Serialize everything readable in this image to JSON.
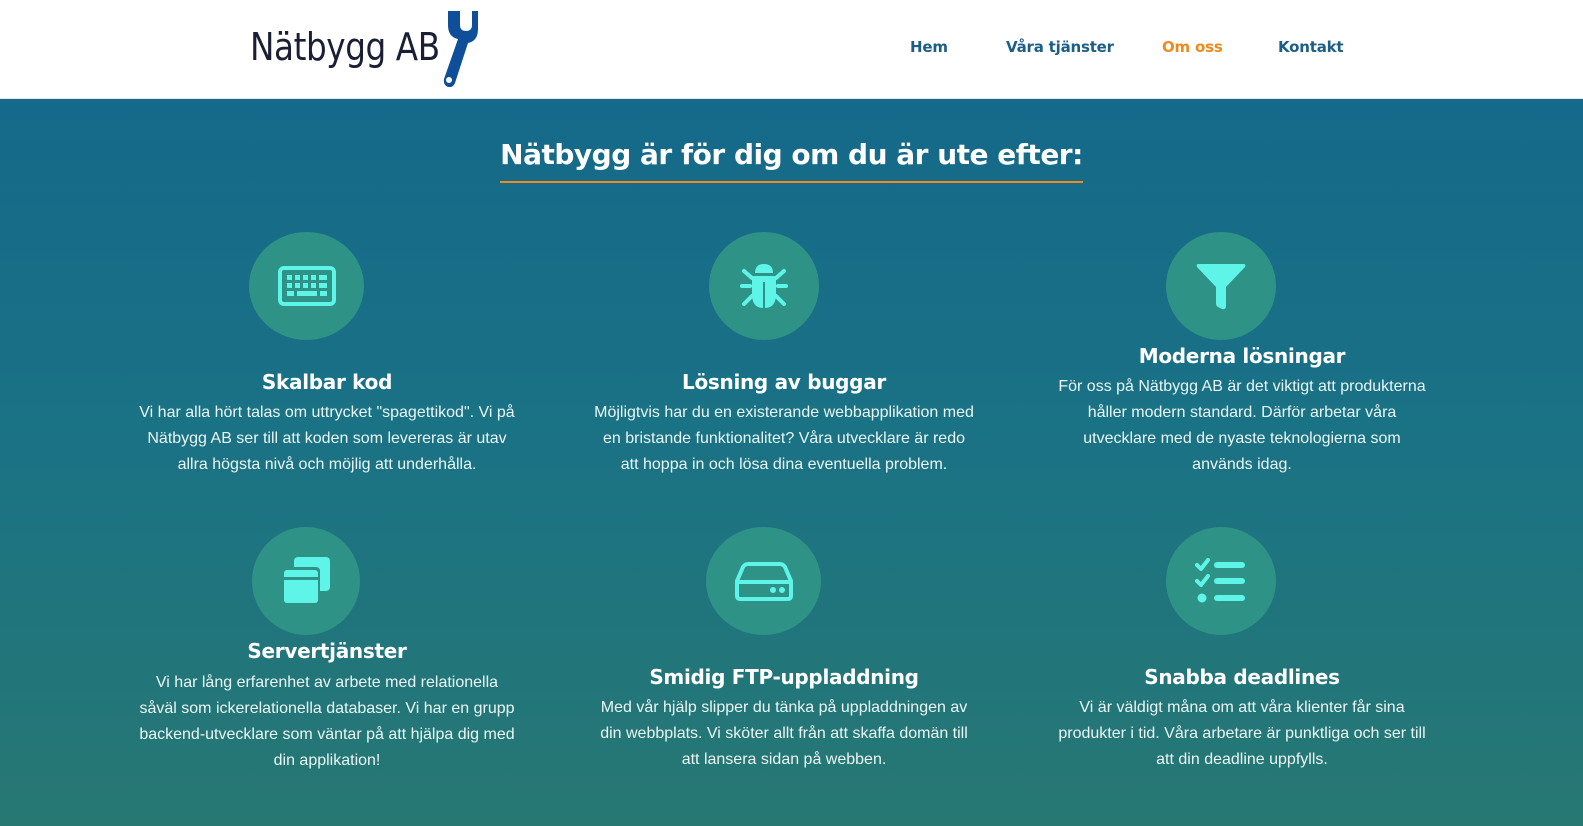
{
  "header": {
    "logo_text": "Nätbygg AB",
    "logo_icon": "wrench-icon",
    "nav": [
      {
        "label": "Hem",
        "active": false
      },
      {
        "label": "Våra tjänster",
        "active": false
      },
      {
        "label": "Om oss",
        "active": true
      },
      {
        "label": "Kontakt",
        "active": false
      }
    ]
  },
  "main": {
    "title": "Nätbygg är för dig om du är ute efter:",
    "features": [
      {
        "icon": "keyboard-icon",
        "title": "Skalbar kod",
        "text": "Vi har alla hört talas om uttrycket \"spagettikod\". Vi på Nätbygg AB ser till att koden som levereras är utav allra högsta nivå och möjlig att underhålla."
      },
      {
        "icon": "bug-icon",
        "title": "Lösning av buggar",
        "text": "Möjligtvis har du en existerande webbapplikation med en bristande funktionalitet? Våra utvecklare är redo att hoppa in och lösa dina eventuella problem."
      },
      {
        "icon": "filter-icon",
        "title": "Moderna lösningar",
        "text": "För oss på Nätbygg AB är det viktigt att produkterna håller modern standard. Därför arbetar våra utvecklare med de nyaste teknologierna som används idag."
      },
      {
        "icon": "windows-icon",
        "title": "Servertjänster",
        "text": "Vi har lång erfarenhet av arbete med relationella såväl som ickerelationella databaser. Vi har en grupp backend-utvecklare som väntar på att hjälpa dig med din applikation!"
      },
      {
        "icon": "hdd-icon",
        "title": "Smidig FTP-uppladdning",
        "text": "Med vår hjälp slipper du tänka på uppladdningen av din webbplats. Vi sköter allt från att skaffa domän till att lansera sidan på webben."
      },
      {
        "icon": "checklist-icon",
        "title": "Snabba deadlines",
        "text": "Vi är väldigt måna om att våra klienter får sina produkter i tid. Våra arbetare är punktliga och ser till att din deadline uppfylls."
      }
    ]
  },
  "colors": {
    "accent": "#f08a1c",
    "nav_link": "#1b5e86",
    "icon_circle": "#2e9386",
    "icon": "#5ef5e8",
    "background_top": "#15698a",
    "background_bottom": "#277873"
  }
}
